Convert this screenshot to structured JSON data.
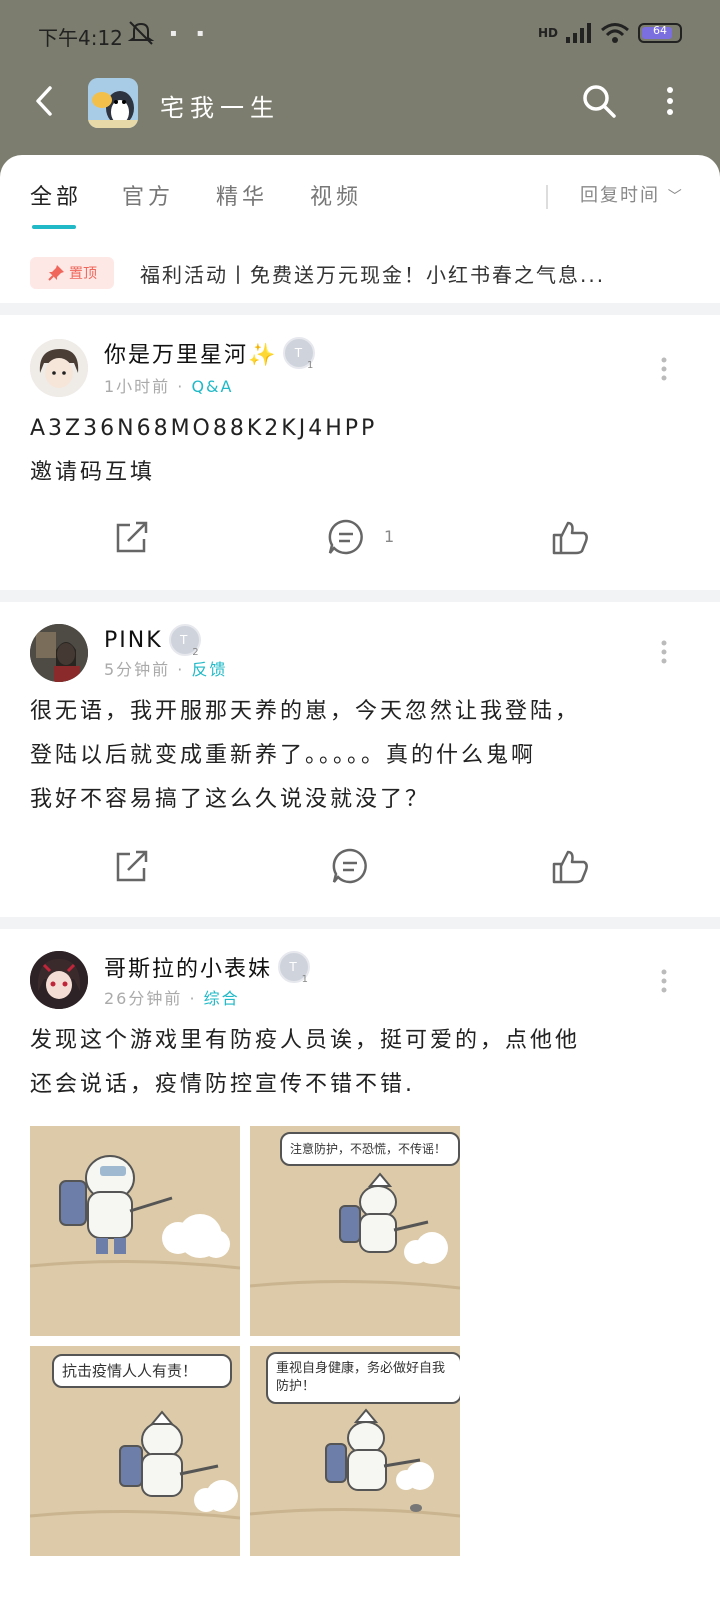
{
  "status": {
    "time": "下午4:12",
    "network": "HD",
    "battery": "64"
  },
  "header": {
    "title": "宅我一生"
  },
  "tabs": [
    {
      "label": "全部"
    },
    {
      "label": "官方"
    },
    {
      "label": "精华"
    },
    {
      "label": "视频"
    }
  ],
  "sort_label": "回复时间",
  "pinned": {
    "badge": "置顶",
    "text": "福利活动丨免费送万元现金！小红书春之气息..."
  },
  "posts": [
    {
      "author": "你是万里星河✨",
      "level": "1",
      "time": "1小时前",
      "category": "Q&A",
      "lines": [
        "A3Z36N68MO88K2KJ4HPP",
        "邀请码互填"
      ],
      "comments": "1"
    },
    {
      "author": "PINK",
      "level": "2",
      "time": "5分钟前",
      "category": "反馈",
      "lines": [
        "很无语，我开服那天养的崽，今天忽然让我登陆，",
        "登陆以后就变成重新养了。。。。。真的什么鬼啊",
        "我好不容易搞了这么久说没就没了？"
      ]
    },
    {
      "author": "哥斯拉的小表妹",
      "level": "1",
      "time": "26分钟前",
      "category": "综合",
      "lines": [
        "发现这个游戏里有防疫人员诶，挺可爱的，点他他",
        "还会说话，疫情防控宣传不错不错."
      ],
      "bubbles": [
        "注意防护，不恐慌，不传谣！",
        "抗击疫情人人有责！",
        "重视自身健康，务必做好自我防护！"
      ]
    }
  ],
  "colors": {
    "accent": "#21b9c7",
    "header": "#7c7d6e",
    "pin": "#f0665a"
  }
}
